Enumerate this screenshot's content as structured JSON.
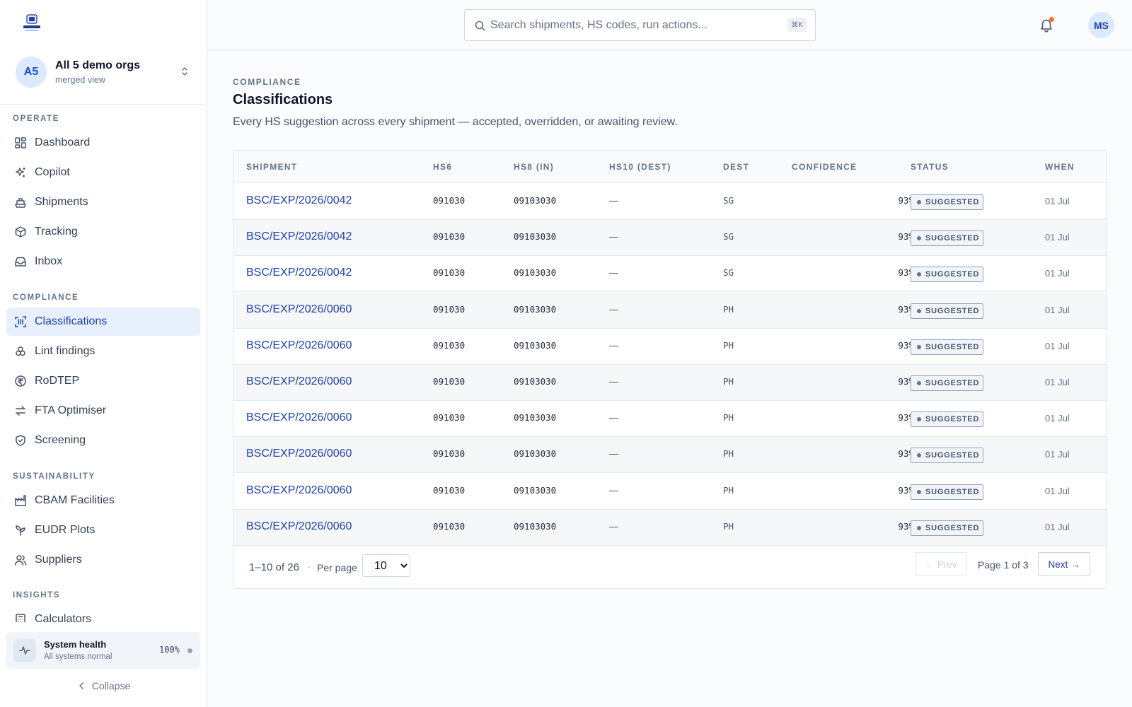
{
  "sidebar": {
    "org": {
      "initials": "A5",
      "name": "All 5 demo orgs",
      "subtitle": "merged view"
    },
    "sections": {
      "operate": "OPERATE",
      "compliance": "COMPLIANCE",
      "sustainability": "SUSTAINABILITY",
      "insights": "INSIGHTS"
    },
    "items": {
      "dashboard": "Dashboard",
      "copilot": "Copilot",
      "shipments": "Shipments",
      "tracking": "Tracking",
      "inbox": "Inbox",
      "classifications": "Classifications",
      "lint_findings": "Lint findings",
      "rodtep": "RoDTEP",
      "fta_optimiser": "FTA Optimiser",
      "screening": "Screening",
      "cbam_facilities": "CBAM Facilities",
      "eudr_plots": "EUDR Plots",
      "suppliers": "Suppliers",
      "calculators": "Calculators"
    },
    "active_item": "Classifications",
    "health": {
      "title": "System health",
      "subtitle": "All systems normal",
      "value": "100%"
    },
    "collapse_label": "Collapse"
  },
  "topbar": {
    "search_placeholder": "Search shipments, HS codes, run actions...",
    "shortcut": "⌘K",
    "user_initials": "MS",
    "has_notification": true
  },
  "page": {
    "eyebrow": "COMPLIANCE",
    "title": "Classifications",
    "description": "Every HS suggestion across every shipment — accepted, overridden, or awaiting review."
  },
  "table": {
    "columns": [
      "SHIPMENT",
      "HS6",
      "HS8 (IN)",
      "HS10 (DEST)",
      "DEST",
      "CONFIDENCE",
      "STATUS",
      "WHEN"
    ],
    "rows": [
      {
        "shipment": "BSC/EXP/2026/0042",
        "hs6": "091030",
        "hs8": "09103030",
        "hs10": "—",
        "dest": "SG",
        "confidence": "93%",
        "status": "SUGGESTED",
        "when": "01 Jul"
      },
      {
        "shipment": "BSC/EXP/2026/0042",
        "hs6": "091030",
        "hs8": "09103030",
        "hs10": "—",
        "dest": "SG",
        "confidence": "93%",
        "status": "SUGGESTED",
        "when": "01 Jul"
      },
      {
        "shipment": "BSC/EXP/2026/0042",
        "hs6": "091030",
        "hs8": "09103030",
        "hs10": "—",
        "dest": "SG",
        "confidence": "93%",
        "status": "SUGGESTED",
        "when": "01 Jul"
      },
      {
        "shipment": "BSC/EXP/2026/0060",
        "hs6": "091030",
        "hs8": "09103030",
        "hs10": "—",
        "dest": "PH",
        "confidence": "93%",
        "status": "SUGGESTED",
        "when": "01 Jul"
      },
      {
        "shipment": "BSC/EXP/2026/0060",
        "hs6": "091030",
        "hs8": "09103030",
        "hs10": "—",
        "dest": "PH",
        "confidence": "93%",
        "status": "SUGGESTED",
        "when": "01 Jul"
      },
      {
        "shipment": "BSC/EXP/2026/0060",
        "hs6": "091030",
        "hs8": "09103030",
        "hs10": "—",
        "dest": "PH",
        "confidence": "93%",
        "status": "SUGGESTED",
        "when": "01 Jul"
      },
      {
        "shipment": "BSC/EXP/2026/0060",
        "hs6": "091030",
        "hs8": "09103030",
        "hs10": "—",
        "dest": "PH",
        "confidence": "93%",
        "status": "SUGGESTED",
        "when": "01 Jul"
      },
      {
        "shipment": "BSC/EXP/2026/0060",
        "hs6": "091030",
        "hs8": "09103030",
        "hs10": "—",
        "dest": "PH",
        "confidence": "93%",
        "status": "SUGGESTED",
        "when": "01 Jul"
      },
      {
        "shipment": "BSC/EXP/2026/0060",
        "hs6": "091030",
        "hs8": "09103030",
        "hs10": "—",
        "dest": "PH",
        "confidence": "93%",
        "status": "SUGGESTED",
        "when": "01 Jul"
      },
      {
        "shipment": "BSC/EXP/2026/0060",
        "hs6": "091030",
        "hs8": "09103030",
        "hs10": "—",
        "dest": "PH",
        "confidence": "93%",
        "status": "SUGGESTED",
        "when": "01 Jul"
      }
    ]
  },
  "pagination": {
    "range": "1–10 of 26",
    "separator": "·",
    "per_page_label": "Per page",
    "per_page_value": "10",
    "prev_label": "← Prev",
    "page_info": "Page 1 of 3",
    "next_label": "Next →"
  },
  "colors": {
    "accent": "#1e40af",
    "active_bg": "#e8f0fe",
    "notification": "#f97316"
  }
}
